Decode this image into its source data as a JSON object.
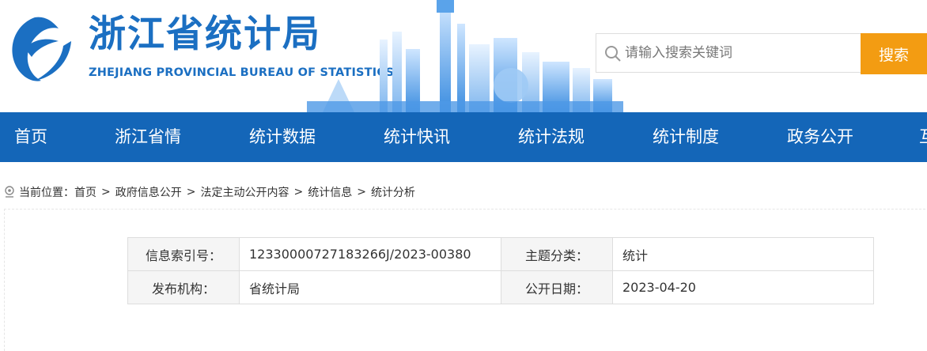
{
  "header": {
    "logo_cn": "浙江省统计局",
    "logo_en": "ZHEJIANG PROVINCIAL BUREAU OF STATISTICS",
    "search_placeholder": "请输入搜索关键词",
    "search_button": "搜索",
    "brand_color": "#1b6fc2",
    "accent_color": "#f39c12"
  },
  "nav": {
    "background": "#1466b8",
    "items": [
      "首页",
      "浙江省情",
      "统计数据",
      "统计快讯",
      "统计法规",
      "统计制度",
      "政务公开",
      "互"
    ]
  },
  "breadcrumb": {
    "prefix": "当前位置：",
    "items": [
      "首页",
      "政府信息公开",
      "法定主动公开内容",
      "统计信息",
      "统计分析"
    ],
    "separator": ">"
  },
  "info_table": {
    "index_label": "信息索引号：",
    "index_value": "12330000727183266J/2023-00380",
    "topic_label": "主题分类：",
    "topic_value": "统计",
    "publisher_label": "发布机构：",
    "publisher_value": "省统计局",
    "date_label": "公开日期：",
    "date_value": "2023-04-20"
  }
}
